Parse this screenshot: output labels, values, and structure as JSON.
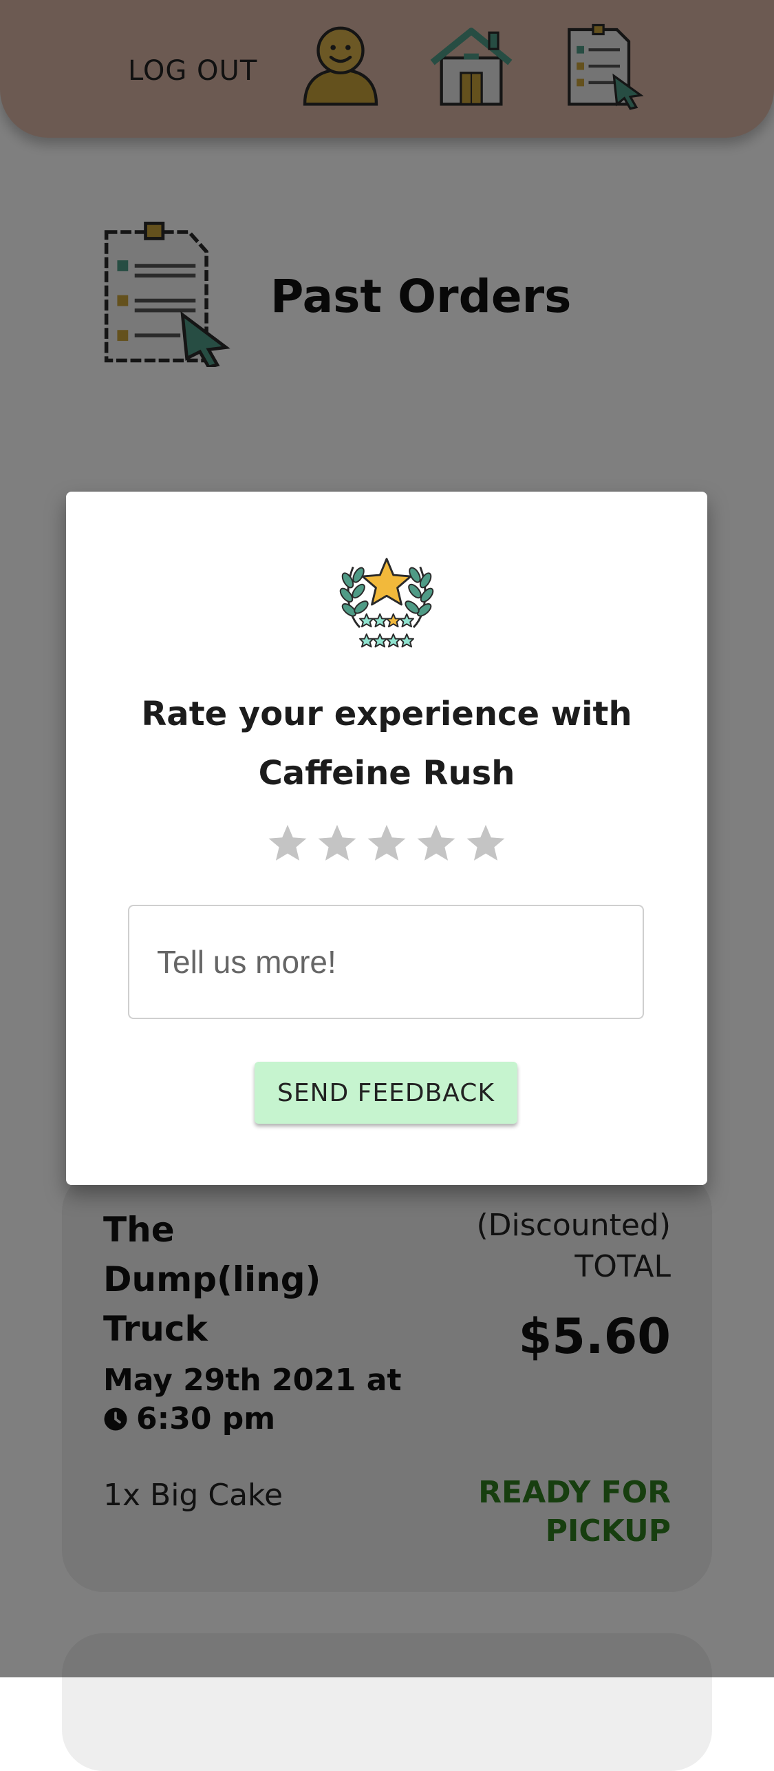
{
  "header": {
    "logout_label": "LOG OUT",
    "icons": [
      "profile-icon",
      "home-icon",
      "orders-icon"
    ]
  },
  "page": {
    "title": "Past Orders"
  },
  "order": {
    "vendor": "The Dump(ling) Truck",
    "date": "May 29th 2021 at",
    "time": "6:30 pm",
    "items": "1x Big Cake",
    "total_label_line1": "(Discounted)",
    "total_label_line2": "TOTAL",
    "price": "$5.60",
    "status": "READY FOR PICKUP",
    "status_color": "#2f7d1e"
  },
  "modal": {
    "title": "Rate your experience with Caffeine Rush",
    "rating": 0,
    "max_rating": 5,
    "feedback_placeholder": "Tell us more!",
    "feedback_value": "",
    "send_label": "SEND FEEDBACK",
    "send_color": "#c6f4cf"
  },
  "colors": {
    "header_bg": "#d9b5a4",
    "card_bg": "#eeeeee",
    "star_empty": "#c4c4c4",
    "accent_gold": "#c9a23a",
    "accent_teal": "#4f9b86"
  }
}
